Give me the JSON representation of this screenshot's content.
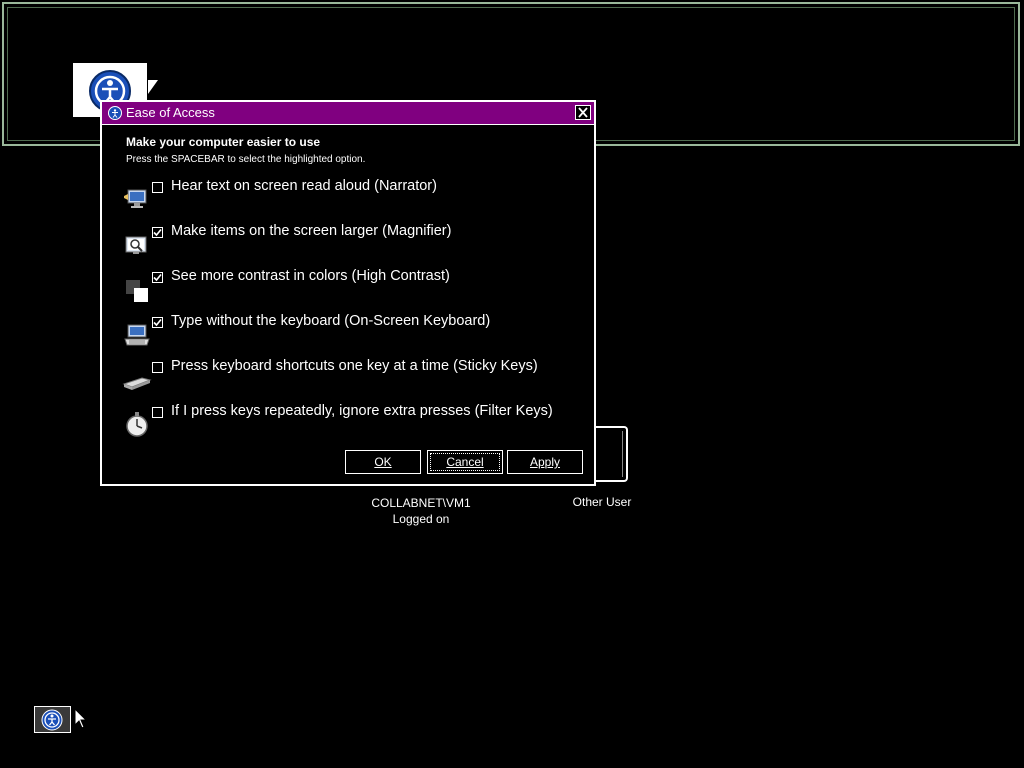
{
  "dialog": {
    "title": "Ease of Access",
    "heading": "Make your computer easier to use",
    "subheading": "Press the SPACEBAR to select the highlighted option.",
    "options": [
      {
        "label": "Hear text on screen read aloud (Narrator)",
        "checked": false,
        "icon": "narrator-icon"
      },
      {
        "label": "Make items on the screen larger (Magnifier)",
        "checked": true,
        "icon": "magnifier-icon"
      },
      {
        "label": "See more contrast in colors (High Contrast)",
        "checked": true,
        "icon": "high-contrast-icon"
      },
      {
        "label": "Type without the keyboard (On-Screen Keyboard)",
        "checked": true,
        "icon": "on-screen-keyboard-icon"
      },
      {
        "label": "Press keyboard shortcuts one key at a time (Sticky Keys)",
        "checked": false,
        "icon": "sticky-keys-icon"
      },
      {
        "label": "If I press keys repeatedly, ignore extra presses (Filter Keys)",
        "checked": false,
        "icon": "filter-keys-icon"
      }
    ],
    "buttons": {
      "ok": "OK",
      "cancel": "Cancel",
      "apply": "Apply"
    }
  },
  "login": {
    "user_name": "COLLABNET\\VM1",
    "user_status": "Logged on",
    "other_user": "Other User"
  },
  "colors": {
    "titlebar": "#800080",
    "background": "#000000",
    "foreground": "#ffffff",
    "frame": "#9ab89a"
  }
}
